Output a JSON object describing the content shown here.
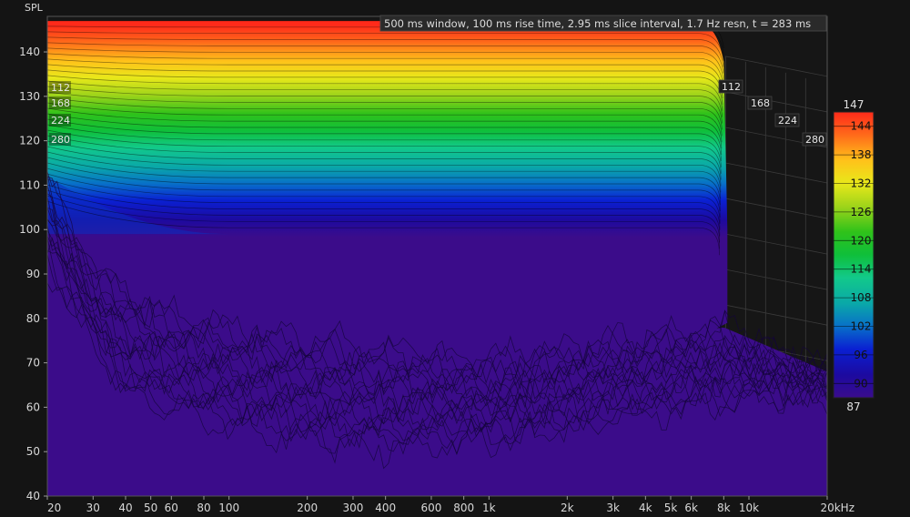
{
  "chart_data": {
    "type": "waterfall",
    "ylabel": "SPL",
    "xunit": "kHz",
    "info": "500 ms window, 100 ms rise time, 2.95 ms slice interval, 1.7 Hz resn, t = 283 ms",
    "xscale": "log",
    "xlim": [
      20,
      20000
    ],
    "ylim": [
      40,
      148
    ],
    "x_ticks": [
      {
        "v": 20,
        "label": "20"
      },
      {
        "v": 30,
        "label": "30"
      },
      {
        "v": 40,
        "label": "40"
      },
      {
        "v": 50,
        "label": "50"
      },
      {
        "v": 60,
        "label": "60"
      },
      {
        "v": 80,
        "label": "80"
      },
      {
        "v": 100,
        "label": "100"
      },
      {
        "v": 200,
        "label": "200"
      },
      {
        "v": 300,
        "label": "300"
      },
      {
        "v": 400,
        "label": "400"
      },
      {
        "v": 600,
        "label": "600"
      },
      {
        "v": 800,
        "label": "800"
      },
      {
        "v": 1000,
        "label": "1k"
      },
      {
        "v": 2000,
        "label": "2k"
      },
      {
        "v": 3000,
        "label": "3k"
      },
      {
        "v": 4000,
        "label": "4k"
      },
      {
        "v": 5000,
        "label": "5k"
      },
      {
        "v": 6000,
        "label": "6k"
      },
      {
        "v": 8000,
        "label": "8k"
      },
      {
        "v": 10000,
        "label": "10k"
      },
      {
        "v": 20000,
        "label": "20kHz"
      }
    ],
    "y_ticks": [
      40,
      50,
      60,
      70,
      80,
      90,
      100,
      110,
      120,
      130,
      140
    ],
    "time_markers_ms": [
      "112",
      "168",
      "224",
      "280"
    ],
    "colorbar": {
      "min": 87,
      "max": 147,
      "ticks": [
        144,
        138,
        132,
        126,
        120,
        114,
        108,
        102,
        96,
        90
      ],
      "min_label": "87",
      "max_label": "147"
    },
    "decay": {
      "start_level": 147,
      "floor_level": 99,
      "hf_rolloff_hz": 7500,
      "noise_floor_start": [
        {
          "hz": 20,
          "db": 112
        },
        {
          "hz": 30,
          "db": 90
        },
        {
          "hz": 60,
          "db": 80
        },
        {
          "hz": 200,
          "db": 75
        },
        {
          "hz": 1000,
          "db": 70
        },
        {
          "hz": 8000,
          "db": 78
        },
        {
          "hz": 20000,
          "db": 68
        }
      ],
      "noise_floor_bottom": [
        {
          "hz": 20,
          "db": 92
        },
        {
          "hz": 40,
          "db": 62
        },
        {
          "hz": 100,
          "db": 55
        },
        {
          "hz": 300,
          "db": 50
        },
        {
          "hz": 1000,
          "db": 52
        },
        {
          "hz": 6000,
          "db": 60
        },
        {
          "hz": 20000,
          "db": 63
        }
      ]
    }
  }
}
